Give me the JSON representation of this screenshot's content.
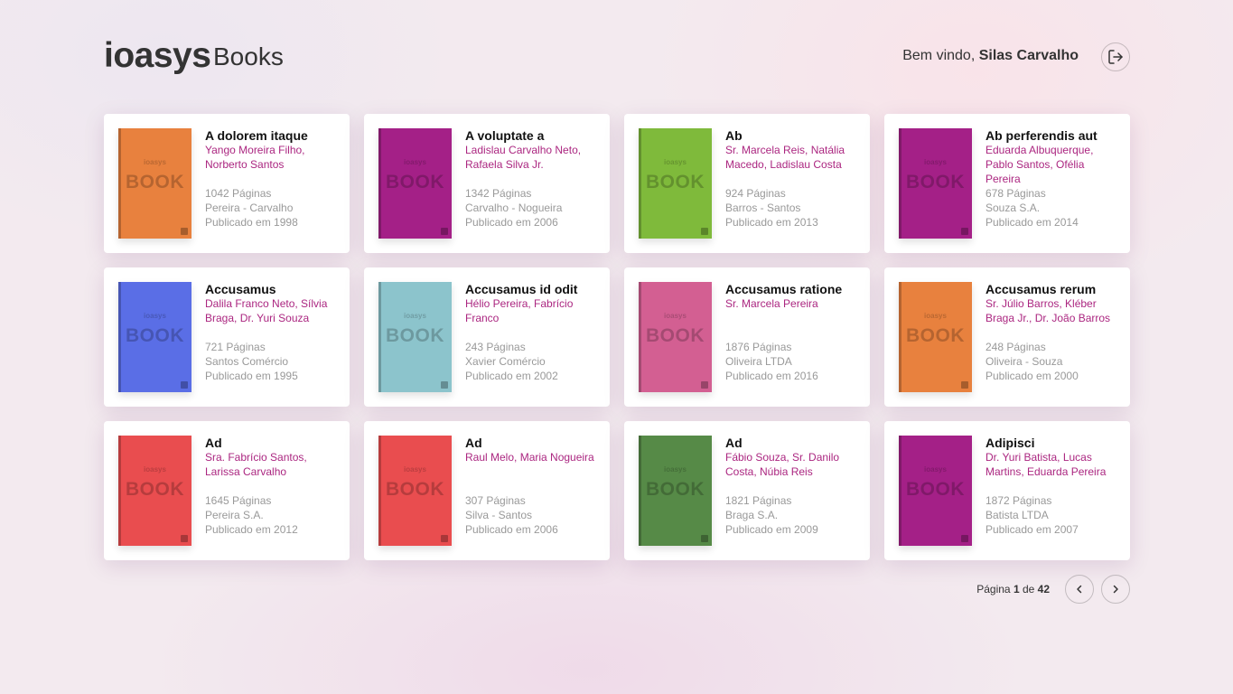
{
  "header": {
    "logo_text": "ioasys",
    "app_name": "Books",
    "welcome_prefix": "Bem vindo, ",
    "user_name": "Silas Carvalho"
  },
  "cover": {
    "brand": "ioasys",
    "word": "BOOK"
  },
  "books": [
    {
      "title": "A dolorem itaque",
      "authors": "Yango Moreira Filho, Norberto Santos",
      "pages": "1042 Páginas",
      "publisher": "Pereira - Carvalho",
      "published": "Publicado em 1998",
      "cover_color": "#e8813e"
    },
    {
      "title": "A voluptate a",
      "authors": "Ladislau Carvalho Neto, Rafaela Silva Jr.",
      "pages": "1342 Páginas",
      "publisher": "Carvalho - Nogueira",
      "published": "Publicado em 2006",
      "cover_color": "#a42087"
    },
    {
      "title": "Ab",
      "authors": "Sr. Marcela Reis, Natália Macedo, Ladislau Costa",
      "pages": "924 Páginas",
      "publisher": "Barros - Santos",
      "published": "Publicado em 2013",
      "cover_color": "#7fba3b"
    },
    {
      "title": "Ab perferendis aut",
      "authors": "Eduarda Albuquerque, Pablo Santos, Ofélia Pereira",
      "pages": "678 Páginas",
      "publisher": "Souza S.A.",
      "published": "Publicado em 2014",
      "cover_color": "#a42087"
    },
    {
      "title": "Accusamus",
      "authors": "Dalila Franco Neto, Sílvia Braga, Dr. Yuri Souza",
      "pages": "721 Páginas",
      "publisher": "Santos Comércio",
      "published": "Publicado em 1995",
      "cover_color": "#5a6ee6"
    },
    {
      "title": "Accusamus id odit",
      "authors": "Hélio Pereira, Fabrício Franco",
      "pages": "243 Páginas",
      "publisher": "Xavier Comércio",
      "published": "Publicado em 2002",
      "cover_color": "#8cc4cc"
    },
    {
      "title": "Accusamus ratione",
      "authors": "Sr. Marcela Pereira",
      "pages": "1876 Páginas",
      "publisher": "Oliveira LTDA",
      "published": "Publicado em 2016",
      "cover_color": "#d35f92"
    },
    {
      "title": "Accusamus rerum",
      "authors": "Sr. Júlio Barros, Kléber Braga Jr., Dr. João Barros",
      "pages": "248 Páginas",
      "publisher": "Oliveira - Souza",
      "published": "Publicado em 2000",
      "cover_color": "#e8813e"
    },
    {
      "title": "Ad",
      "authors": "Sra. Fabrício Santos, Larissa Carvalho",
      "pages": "1645 Páginas",
      "publisher": "Pereira S.A.",
      "published": "Publicado em 2012",
      "cover_color": "#e94d4f"
    },
    {
      "title": "Ad",
      "authors": "Raul Melo, Maria Nogueira",
      "pages": "307 Páginas",
      "publisher": "Silva - Santos",
      "published": "Publicado em 2006",
      "cover_color": "#e94d4f"
    },
    {
      "title": "Ad",
      "authors": "Fábio Souza, Sr. Danilo Costa, Núbia Reis",
      "pages": "1821 Páginas",
      "publisher": "Braga S.A.",
      "published": "Publicado em 2009",
      "cover_color": "#568a47"
    },
    {
      "title": "Adipisci",
      "authors": "Dr. Yuri Batista, Lucas Martins, Eduarda Pereira",
      "pages": "1872 Páginas",
      "publisher": "Batista LTDA",
      "published": "Publicado em 2007",
      "cover_color": "#a42087"
    }
  ],
  "pagination": {
    "prefix": "Página ",
    "current": "1",
    "separator": " de ",
    "total": "42"
  }
}
